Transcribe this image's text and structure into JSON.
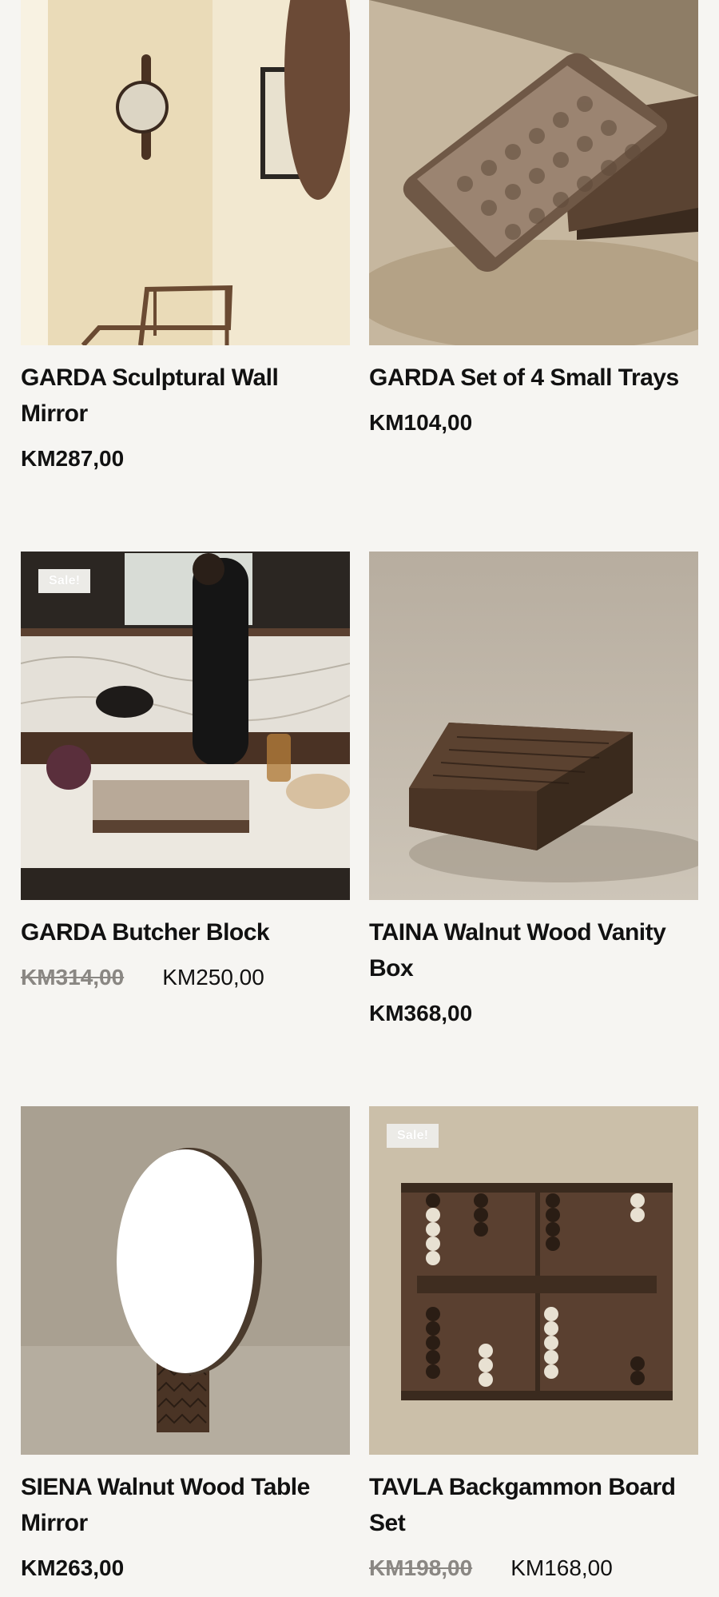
{
  "colors": {
    "background": "#f6f5f2",
    "text": "#111111",
    "old_price": "#8a8783",
    "badge_bg": "#ecebe7"
  },
  "products": [
    {
      "title": "GARDA Sculptural Wall Mirror",
      "price": "KM287,00",
      "image_icon": "wall-mirror-image"
    },
    {
      "title": "GARDA Set of 4 Small Trays",
      "price": "KM104,00",
      "image_icon": "trays-image"
    },
    {
      "title": "GARDA Butcher Block",
      "old_price": "KM314,00",
      "price": "KM250,00",
      "badge": "Sale!",
      "image_icon": "butcher-block-image"
    },
    {
      "title": "TAINA Walnut Wood Vanity Box",
      "price": "KM368,00",
      "image_icon": "vanity-box-image"
    },
    {
      "title": "SIENA Walnut Wood Table Mirror",
      "price": "KM263,00",
      "image_icon": "table-mirror-image"
    },
    {
      "title": "TAVLA Backgammon Board Set",
      "old_price": "KM198,00",
      "price": "KM168,00",
      "badge": "Sale!",
      "image_icon": "backgammon-image"
    }
  ]
}
